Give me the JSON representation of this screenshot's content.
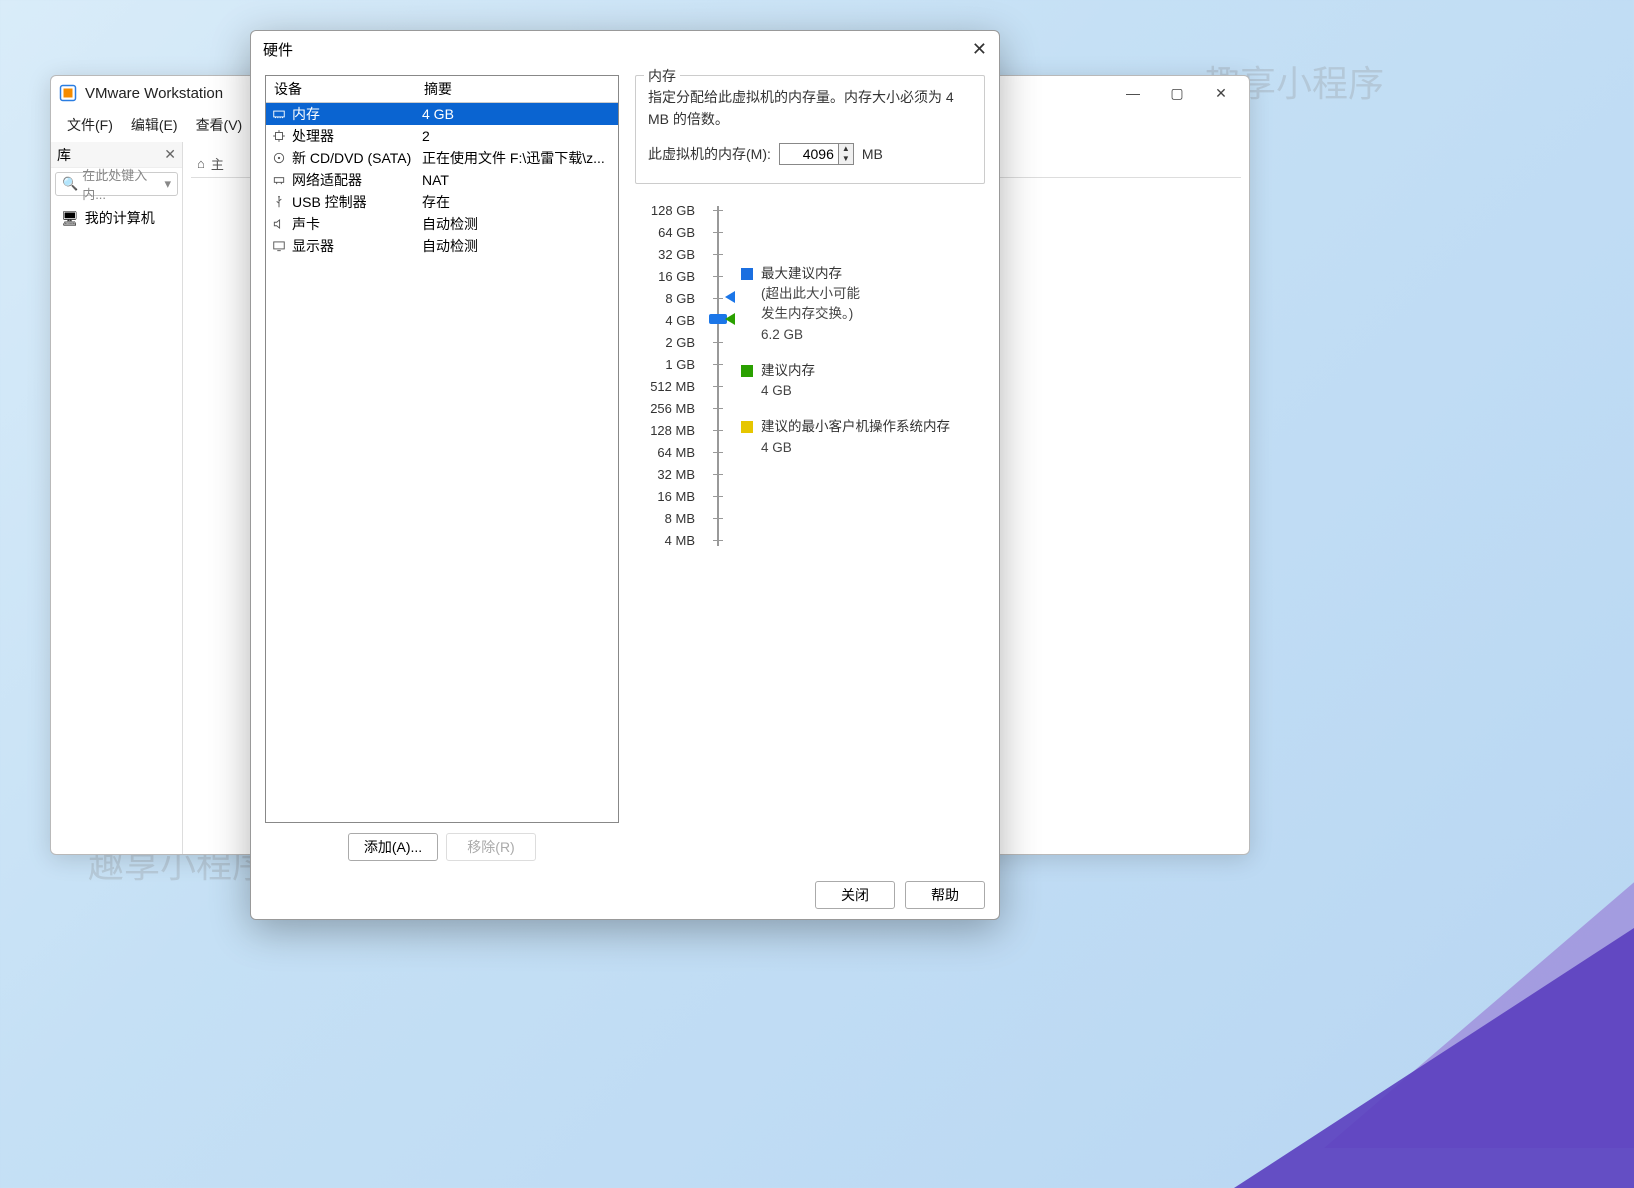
{
  "watermark": "趣享小程序",
  "main": {
    "title": "VMware Workstation",
    "menus": [
      "文件(F)",
      "编辑(E)",
      "查看(V)"
    ],
    "library": {
      "title": "库",
      "search_placeholder": "在此处键入内...",
      "root_node": "我的计算机"
    },
    "home_tab": "主"
  },
  "dialog": {
    "title": "硬件",
    "columns": {
      "device": "设备",
      "summary": "摘要"
    },
    "hardware": [
      {
        "icon": "memory",
        "name": "内存",
        "summary": "4 GB",
        "selected": true
      },
      {
        "icon": "cpu",
        "name": "处理器",
        "summary": "2"
      },
      {
        "icon": "disc",
        "name": "新 CD/DVD (SATA)",
        "summary": "正在使用文件 F:\\迅雷下载\\z..."
      },
      {
        "icon": "network",
        "name": "网络适配器",
        "summary": "NAT"
      },
      {
        "icon": "usb",
        "name": "USB 控制器",
        "summary": "存在"
      },
      {
        "icon": "sound",
        "name": "声卡",
        "summary": "自动检测"
      },
      {
        "icon": "display",
        "name": "显示器",
        "summary": "自动检测"
      }
    ],
    "buttons": {
      "add": "添加(A)...",
      "remove": "移除(R)",
      "close": "关闭",
      "help": "帮助"
    },
    "memory_panel": {
      "legend": "内存",
      "desc": "指定分配给此虚拟机的内存量。内存大小必须为 4 MB 的倍数。",
      "field_label": "此虚拟机的内存(M):",
      "value": "4096",
      "unit": "MB",
      "ticks": [
        "128 GB",
        "64 GB",
        "32 GB",
        "16 GB",
        "8 GB",
        "4 GB",
        "2 GB",
        "1 GB",
        "512 MB",
        "256 MB",
        "128 MB",
        "64 MB",
        "32 MB",
        "16 MB",
        "8 MB",
        "4 MB"
      ],
      "hints": {
        "max": {
          "title": "最大建议内存",
          "sub1": "(超出此大小可能",
          "sub2": "发生内存交换。)",
          "value": "6.2 GB"
        },
        "rec": {
          "title": "建议内存",
          "value": "4 GB"
        },
        "min": {
          "title": "建议的最小客户机操作系统内存",
          "value": "4 GB"
        }
      }
    }
  }
}
